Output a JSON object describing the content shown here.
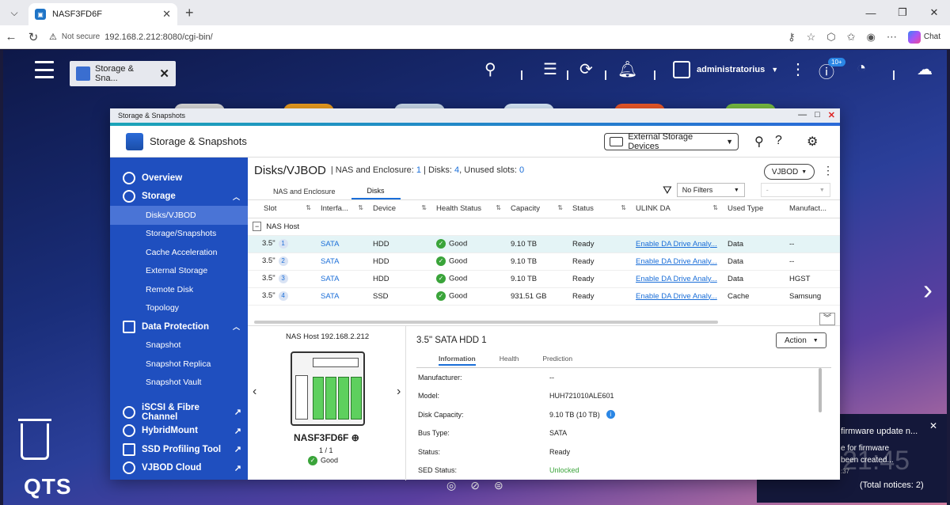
{
  "browser": {
    "tab_title": "NASF3FD6F",
    "not_secure": "Not secure",
    "url": "192.168.2.212:8080/cgi-bin/",
    "chat_label": "Chat"
  },
  "qts": {
    "task_tab": "Storage & Sna...",
    "user": "administratorius",
    "badge": "10+",
    "logo": "QTS"
  },
  "notification": {
    "line1": "firmware update n...",
    "line2": "e for firmware",
    "line3": "been created...",
    "line4": ":37",
    "clock": "21:45",
    "total": "(Total notices: 2)"
  },
  "window": {
    "title": "Storage & Snapshots",
    "app_name": "Storage & Snapshots",
    "external_devices": "External Storage Devices"
  },
  "sidebar": {
    "overview": "Overview",
    "storage": "Storage",
    "storage_items": [
      "Disks/VJBOD",
      "Storage/Snapshots",
      "Cache Acceleration",
      "External Storage",
      "Remote Disk",
      "Topology"
    ],
    "data_protection": "Data Protection",
    "dp_items": [
      "Snapshot",
      "Snapshot Replica",
      "Snapshot Vault"
    ],
    "iscsi": "iSCSI & Fibre Channel",
    "hybridmount": "HybridMount",
    "ssd_tool": "SSD Profiling Tool",
    "vjbod_cloud": "VJBOD Cloud"
  },
  "main": {
    "title": "Disks/VJBOD",
    "meta_prefix": "NAS and Enclosure:",
    "enclosures": "1",
    "disks_label": "Disks:",
    "disks": "4",
    "unused_label": ", Unused slots:",
    "unused": "0",
    "vjbod_btn": "VJBOD",
    "tabs": [
      "NAS and Enclosure",
      "Disks"
    ],
    "filter": "No Filters",
    "filter2": "-"
  },
  "table": {
    "headers": [
      "Slot",
      "Interfa...",
      "Device",
      "Health Status",
      "Capacity",
      "Status",
      "ULINK DA",
      "Used Type",
      "Manufact..."
    ],
    "group": "NAS Host",
    "rows": [
      {
        "slot": "3.5\"",
        "num": "1",
        "iface": "SATA",
        "device": "HDD",
        "health": "Good",
        "capacity": "9.10 TB",
        "status": "Ready",
        "ulink": "Enable DA Drive Analy...",
        "used": "Data",
        "mfr": "--"
      },
      {
        "slot": "3.5\"",
        "num": "2",
        "iface": "SATA",
        "device": "HDD",
        "health": "Good",
        "capacity": "9.10 TB",
        "status": "Ready",
        "ulink": "Enable DA Drive Analy...",
        "used": "Data",
        "mfr": "--"
      },
      {
        "slot": "3.5\"",
        "num": "3",
        "iface": "SATA",
        "device": "HDD",
        "health": "Good",
        "capacity": "9.10 TB",
        "status": "Ready",
        "ulink": "Enable DA Drive Analy...",
        "used": "Data",
        "mfr": "HGST"
      },
      {
        "slot": "3.5\"",
        "num": "4",
        "iface": "SATA",
        "device": "SSD",
        "health": "Good",
        "capacity": "931.51 GB",
        "status": "Ready",
        "ulink": "Enable DA Drive Analy...",
        "used": "Cache",
        "mfr": "Samsung"
      }
    ]
  },
  "device": {
    "title": "NAS Host 192.168.2.212",
    "name": "NASF3FD6F",
    "page": "1 / 1",
    "health": "Good"
  },
  "info": {
    "title": "3.5\" SATA HDD 1",
    "action": "Action",
    "tabs": [
      "Information",
      "Health",
      "Prediction"
    ],
    "rows": [
      {
        "k": "Manufacturer:",
        "v": "--"
      },
      {
        "k": "Model:",
        "v": "HUH721010ALE601"
      },
      {
        "k": "Disk Capacity:",
        "v": "9.10 TB (10 TB)"
      },
      {
        "k": "Bus Type:",
        "v": "SATA"
      },
      {
        "k": "Status:",
        "v": "Ready"
      },
      {
        "k": "SED Status:",
        "v": "Unlocked"
      }
    ]
  },
  "colors": {
    "accent": "#1a6ed8",
    "sidebar": "#1f4fbf",
    "good": "#3aa43a"
  }
}
